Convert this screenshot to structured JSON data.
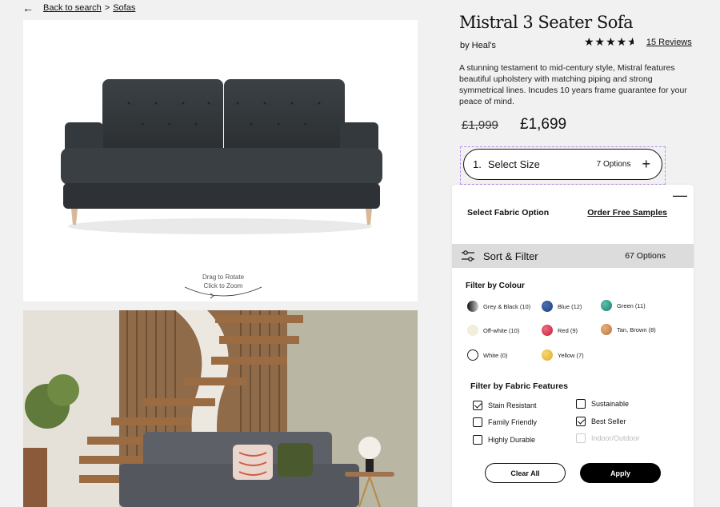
{
  "breadcrumb": {
    "back": "Back to search",
    "separator": ">",
    "category": "Sofas"
  },
  "product": {
    "title": "Mistral 3 Seater Sofa",
    "brand": "by Heal's",
    "rating": 4.5,
    "reviews_link": "15 Reviews",
    "description": "A stunning testament to mid-century style, Mistral features beautiful upholstery with matching piping and strong symmetrical lines. Incudes 10 years frame guarantee for your peace of mind.",
    "price_old": "£1,999",
    "price_new": "£1,699"
  },
  "gallery": {
    "rotate_line1": "Drag to Rotate",
    "rotate_line2": "Click to Zoom"
  },
  "size_selector": {
    "step": "1.",
    "label": "Select Size",
    "options": "7 Options"
  },
  "fabric_panel": {
    "heading": "Select Fabric Option",
    "samples_link": "Order Free Samples",
    "sort_label": "Sort & Filter",
    "sort_count": "67 Options",
    "colour_heading": "Filter by Colour",
    "colours": [
      {
        "label": "Grey & Black (10)",
        "color": "#3a3a3a"
      },
      {
        "label": "Blue (12)",
        "color": "#1f3f7a"
      },
      {
        "label": "Green (11)",
        "color": "#1f8a7a"
      },
      {
        "label": "Off-white (10)",
        "color": "#f2eedc"
      },
      {
        "label": "Red (9)",
        "color": "#d4304a"
      },
      {
        "label": "Tan, Brown (8)",
        "color": "#c98a5a"
      },
      {
        "label": "White (0)",
        "color": "#ffffff"
      },
      {
        "label": "Yellow (7)",
        "color": "#eac048"
      }
    ],
    "features_heading": "Filter by Fabric Features",
    "features": [
      {
        "label": "Stain Resistant",
        "checked": true,
        "disabled": false
      },
      {
        "label": "Sustainable",
        "checked": false,
        "disabled": false
      },
      {
        "label": "Family Friendly",
        "checked": false,
        "disabled": false
      },
      {
        "label": "Best Seller",
        "checked": true,
        "disabled": false
      },
      {
        "label": "Highly Durable",
        "checked": false,
        "disabled": false
      },
      {
        "label": "Indoor/Outdoor",
        "checked": false,
        "disabled": true
      }
    ],
    "clear_label": "Clear All",
    "apply_label": "Apply"
  }
}
